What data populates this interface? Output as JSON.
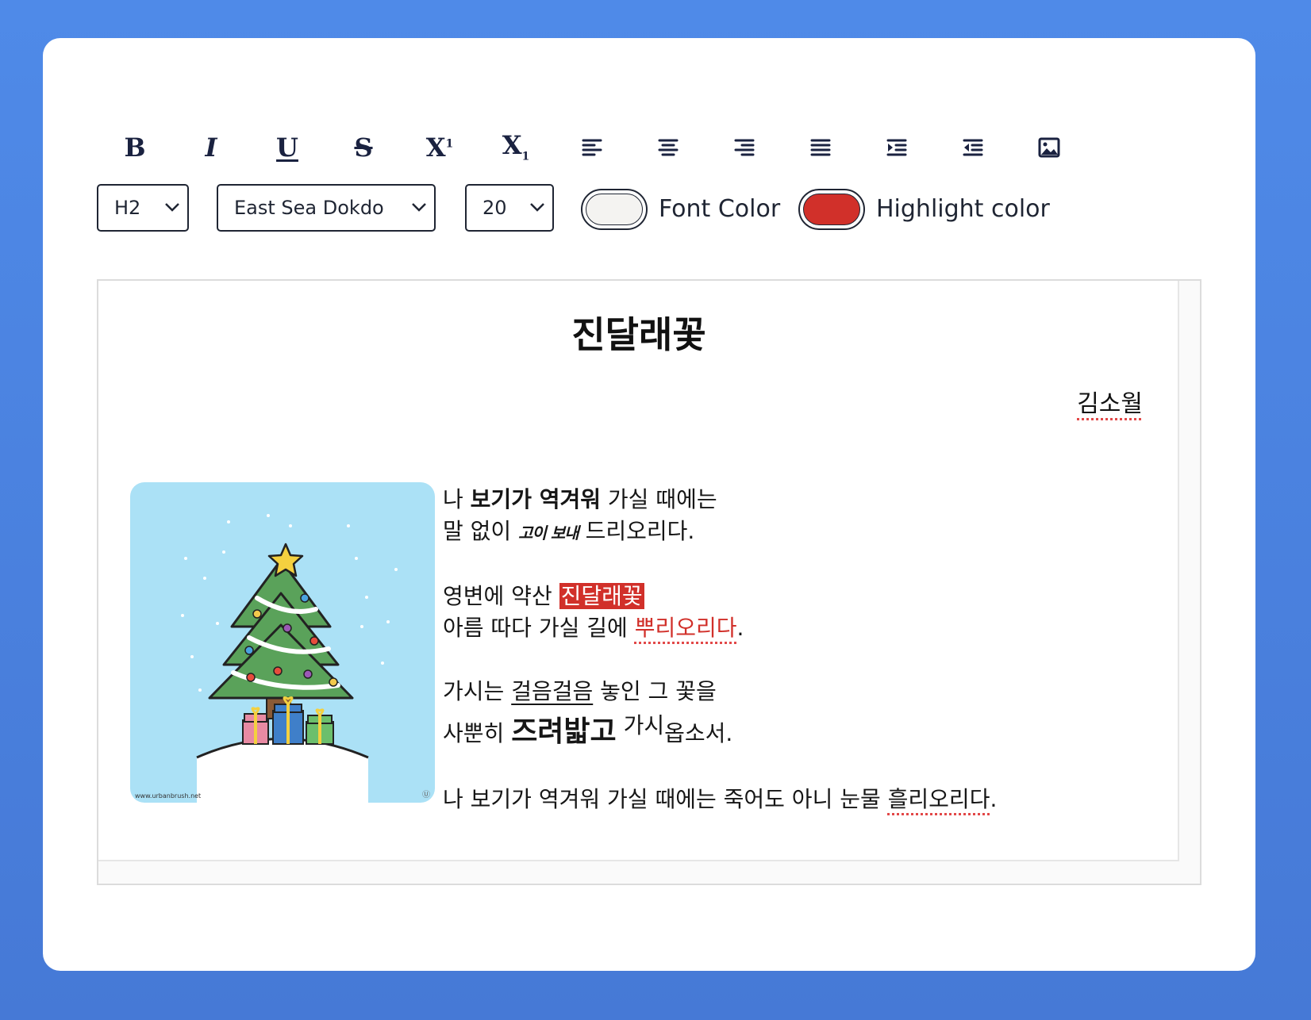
{
  "toolbar": {
    "buttons": [
      {
        "name": "bold",
        "label": "B"
      },
      {
        "name": "italic",
        "label": "I"
      },
      {
        "name": "underline",
        "label": "U"
      },
      {
        "name": "strikethrough",
        "label": "S"
      },
      {
        "name": "superscript",
        "label": "X",
        "mark": "1"
      },
      {
        "name": "subscript",
        "label": "X",
        "mark": "1"
      },
      {
        "name": "align-left"
      },
      {
        "name": "align-center"
      },
      {
        "name": "align-right"
      },
      {
        "name": "align-justify"
      },
      {
        "name": "indent"
      },
      {
        "name": "outdent"
      },
      {
        "name": "insert-image"
      }
    ],
    "heading_select": "H2",
    "font_select": "East Sea Dokdo",
    "size_select": "20",
    "font_color_label": "Font Color",
    "font_color_value": "#f4f3f1",
    "highlight_color_label": "Highlight color",
    "highlight_color_value": "#d1302a"
  },
  "document": {
    "title": "진달래꽃",
    "author": "김소월",
    "image_credit": "www.urbanbrush.net",
    "image_mark": "Ⓤ",
    "stanza1": {
      "line1_a": "나 ",
      "line1_bold": "보기가 역겨워",
      "line1_b": " 가실 때에는",
      "line2_a": "말 없이 ",
      "line2_script": "고이 보내",
      "line2_b": " 드리오리다."
    },
    "stanza2": {
      "line1_a": "영변에 약산 ",
      "line1_highlight": "진달래꽃",
      "line2_a": "아름 따다 가실 길에 ",
      "line2_red": "뿌리오리다",
      "line2_b": "."
    },
    "stanza3": {
      "line1_a": "가시는 ",
      "line1_underline": "걸음걸음",
      "line1_b": " 놓인 그 꽃을",
      "line2_a": "사뿐히 ",
      "line2_big": "즈려밟고",
      "line2_sup": "가시",
      "line2_b": "옵소서."
    },
    "stanza4": {
      "line1_a": "나 보기가 역겨워 가실 때에는 죽어도 아니 눈물 ",
      "line1_spell": "흘리오리다",
      "line1_b": "."
    }
  }
}
